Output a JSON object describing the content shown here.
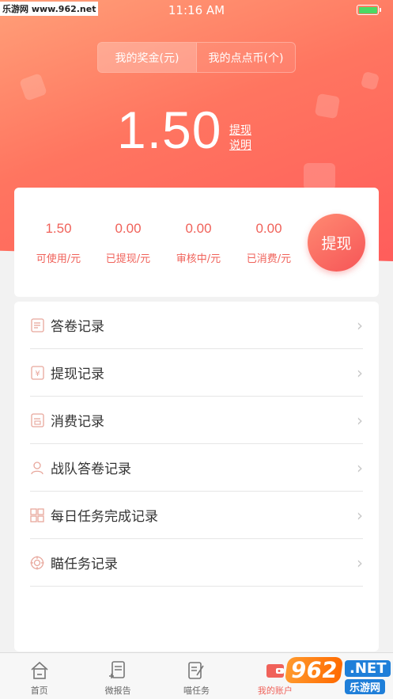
{
  "status_bar": {
    "time": "11:16 AM",
    "watermark": "乐游网 www.962.net"
  },
  "accent_color": "#f0625a",
  "segment": {
    "bonus_tab": "我的奖金(元)",
    "coins_tab": "我的点点币(个)"
  },
  "balance": {
    "amount": "1.50",
    "withdraw_link": "提现",
    "explain_link": "说明"
  },
  "stats": {
    "available": {
      "value": "1.50",
      "label": "可使用/元"
    },
    "withdrawn": {
      "value": "0.00",
      "label": "已提现/元"
    },
    "reviewing": {
      "value": "0.00",
      "label": "审核中/元"
    },
    "spent": {
      "value": "0.00",
      "label": "已消费/元"
    },
    "withdraw_button": "提现"
  },
  "records": [
    {
      "label": "答卷记录",
      "icon": "document-icon"
    },
    {
      "label": "提现记录",
      "icon": "yen-doc-icon"
    },
    {
      "label": "消费记录",
      "icon": "receipt-icon"
    },
    {
      "label": "战队答卷记录",
      "icon": "user-icon"
    },
    {
      "label": "每日任务完成记录",
      "icon": "grid-icon"
    },
    {
      "label": "瞄任务记录",
      "icon": "target-icon"
    }
  ],
  "tabbar": {
    "home": "首页",
    "report": "微报告",
    "tasks": "喵任务",
    "account": "我的账户"
  },
  "watermark_bottom": {
    "brand": "962",
    "net": ".NET",
    "cn": "乐游网"
  }
}
